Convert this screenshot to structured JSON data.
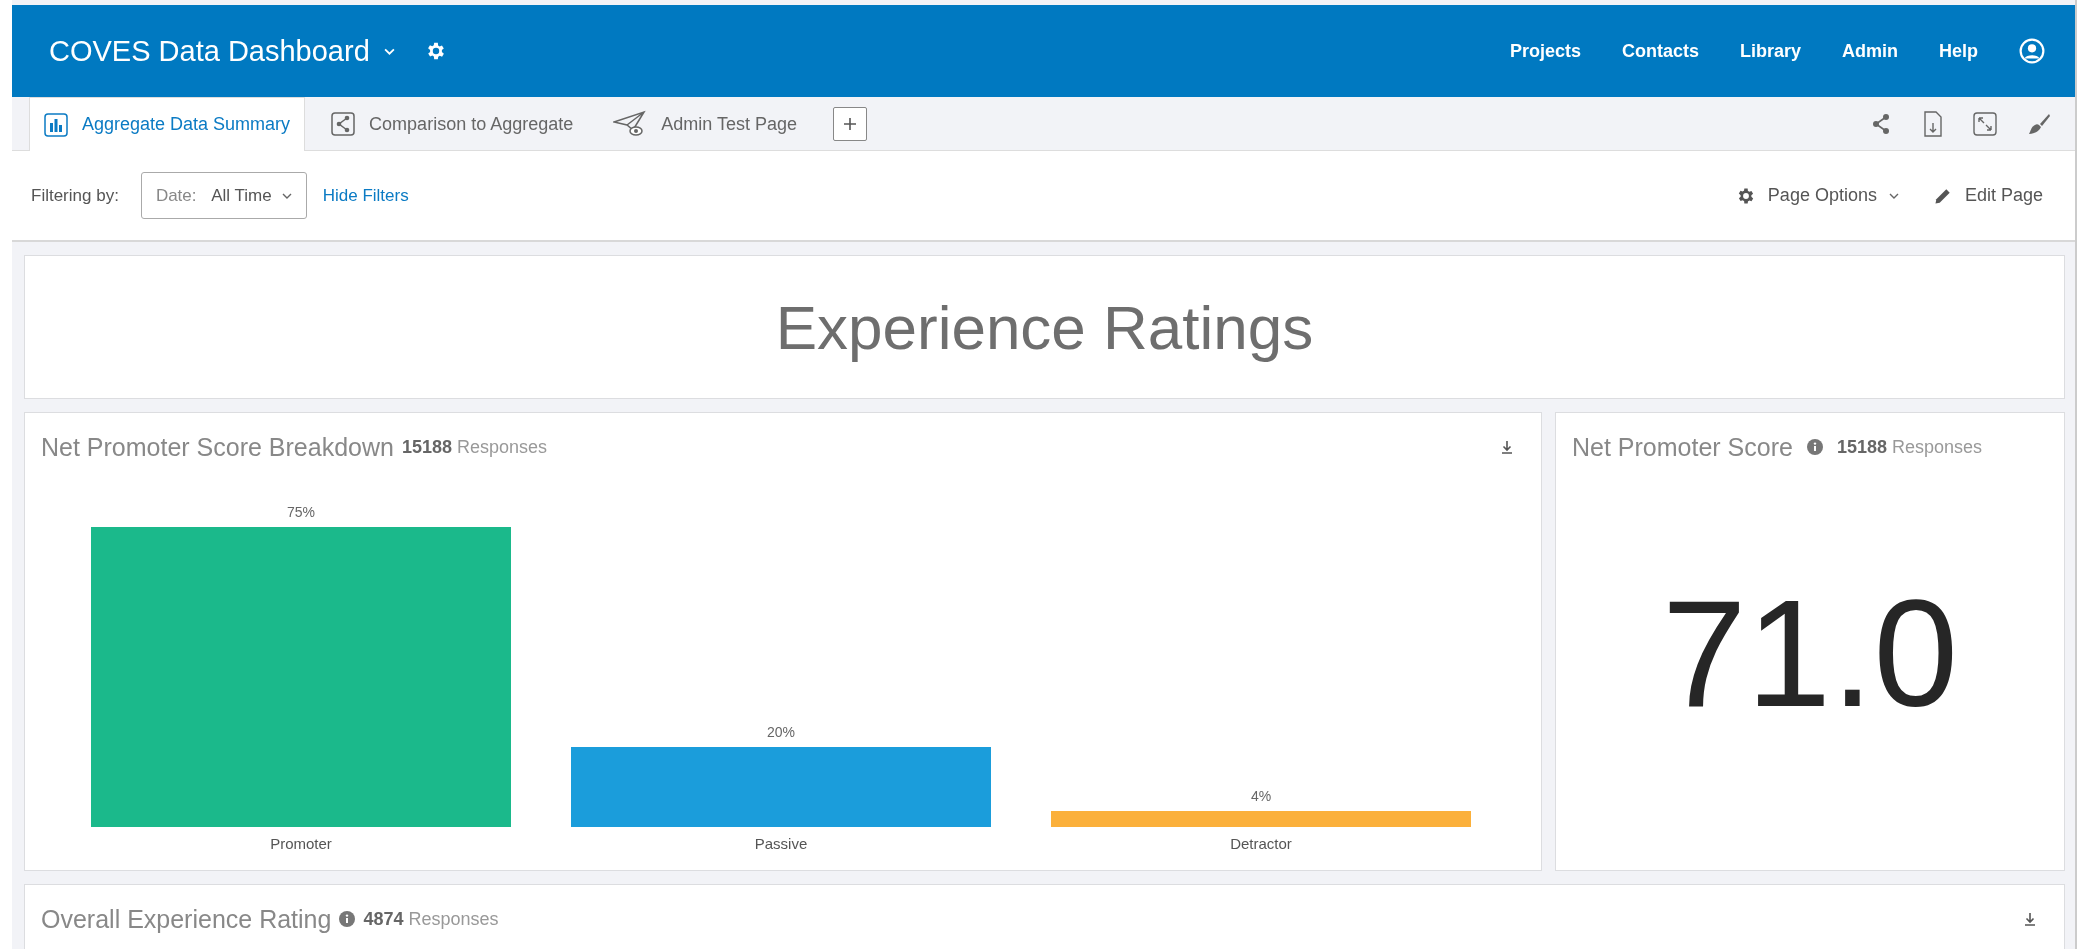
{
  "header": {
    "title": "COVES Data Dashboard",
    "nav": [
      "Projects",
      "Contacts",
      "Library",
      "Admin",
      "Help"
    ]
  },
  "tabs": [
    {
      "label": "Aggregate Data Summary",
      "kind": "bar-chart",
      "selected": true
    },
    {
      "label": "Comparison to Aggregate",
      "kind": "share",
      "selected": false
    },
    {
      "label": "Admin Test Page",
      "kind": "plane",
      "selected": false
    }
  ],
  "filter_bar": {
    "label": "Filtering by:",
    "date_filter": {
      "prefix": "Date:",
      "value": "All Time"
    },
    "hide_filters": "Hide Filters",
    "page_options": "Page Options",
    "edit_page": "Edit Page"
  },
  "section_title": "Experience Ratings",
  "breakdown": {
    "title": "Net Promoter Score Breakdown",
    "count": "15188",
    "count_label": "Responses",
    "chart_data": {
      "type": "bar",
      "categories": [
        "Promoter",
        "Passive",
        "Detractor"
      ],
      "values": [
        75,
        20,
        4
      ],
      "colors": [
        "#1bb98b",
        "#1b9ddb",
        "#fbb03b"
      ],
      "data_labels": true,
      "value_labels": [
        "75%",
        "20%",
        "4%"
      ]
    }
  },
  "nps": {
    "title": "Net Promoter Score",
    "count": "15188",
    "count_label": "Responses",
    "value": "71.0"
  },
  "overall": {
    "title": "Overall Experience Rating",
    "count": "4874",
    "count_label": "Responses"
  }
}
